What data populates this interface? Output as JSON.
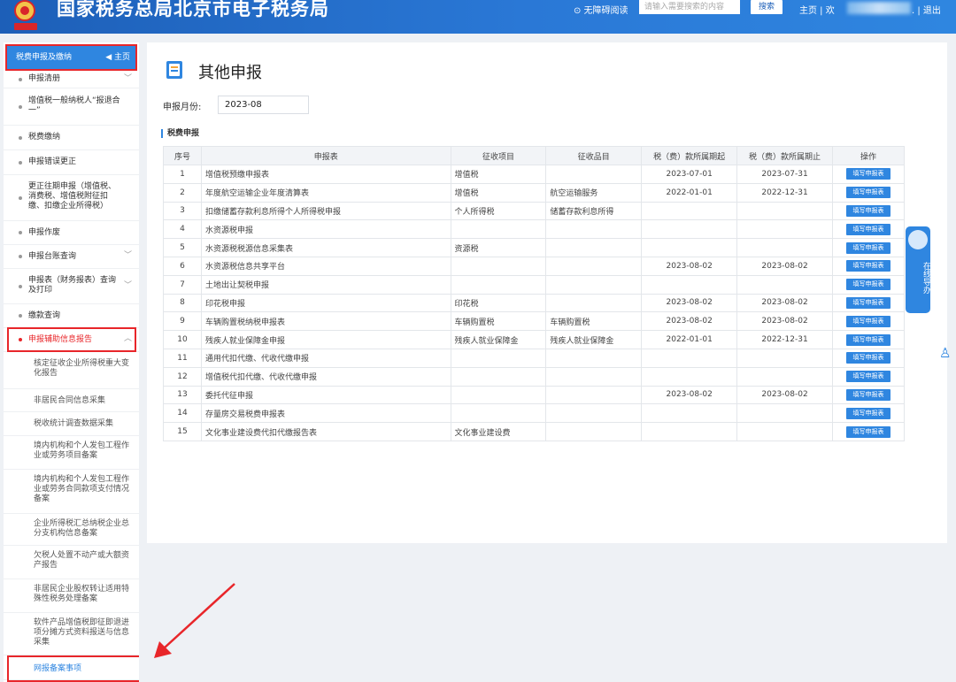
{
  "header": {
    "site_title": "国家税务总局北京市电子税务局",
    "accessibility": "⊙ 无障碍阅读",
    "search_placeholder": "请输入需要搜索的内容",
    "search_button": "搜索",
    "links": "主页 | 欢",
    "logout": ". | 退出"
  },
  "sidebar": {
    "header": "税费申报及缴纳",
    "home": "主页",
    "items": [
      {
        "label": "申报清册"
      },
      {
        "label": "增值税一般纳税人“报退合一”"
      },
      {
        "label": "税费缴纳"
      },
      {
        "label": "申报错误更正"
      },
      {
        "label": "更正往期申报（增值税、消费税、增值税附征扣缴、扣缴企业所得税）"
      },
      {
        "label": "申报作废"
      },
      {
        "label": "申报台账查询"
      },
      {
        "label": "申报表（财务报表）查询及打印"
      },
      {
        "label": "缴款查询"
      },
      {
        "label": "申报辅助信息报告"
      }
    ],
    "subitems": [
      {
        "label": "核定征收企业所得税重大变化报告"
      },
      {
        "label": "非居民合同信息采集"
      },
      {
        "label": "税收统计调查数据采集"
      },
      {
        "label": "境内机构和个人发包工程作业或劳务项目备案"
      },
      {
        "label": "境内机构和个人发包工程作业或劳务合同款项支付情况备案"
      },
      {
        "label": "企业所得税汇总纳税企业总分支机构信息备案"
      },
      {
        "label": "欠税人处置不动产或大额资产报告"
      },
      {
        "label": "非居民企业股权转让适用特殊性税务处理备案"
      },
      {
        "label": "软件产品增值税即征即退进项分摊方式资料报送与信息采集"
      },
      {
        "label": "网报备案事项"
      }
    ]
  },
  "main": {
    "title": "其他申报",
    "month_label": "申报月份:",
    "month_value": "2023-08",
    "section_title": "税费申报",
    "columns": [
      "序号",
      "申报表",
      "征收项目",
      "征收品目",
      "税（费）款所属期起",
      "税（费）款所属期止",
      "操作"
    ],
    "button_label": "填写申报表",
    "rows": [
      {
        "no": "1",
        "name": "增值税预缴申报表",
        "item": "增值税",
        "sub": "",
        "start": "2023-07-01",
        "end": "2023-07-31"
      },
      {
        "no": "2",
        "name": "年度航空运输企业年度清算表",
        "item": "增值税",
        "sub": "航空运输服务",
        "start": "2022-01-01",
        "end": "2022-12-31"
      },
      {
        "no": "3",
        "name": "扣缴储蓄存款利息所得个人所得税申报",
        "item": "个人所得税",
        "sub": "储蓄存款利息所得",
        "start": "",
        "end": ""
      },
      {
        "no": "4",
        "name": "水资源税申报",
        "item": "",
        "sub": "",
        "start": "",
        "end": ""
      },
      {
        "no": "5",
        "name": "水资源税税源信息采集表",
        "item": "资源税",
        "sub": "",
        "start": "",
        "end": ""
      },
      {
        "no": "6",
        "name": "水资源税信息共享平台",
        "item": "",
        "sub": "",
        "start": "2023-08-02",
        "end": "2023-08-02"
      },
      {
        "no": "7",
        "name": "土地出让契税申报",
        "item": "",
        "sub": "",
        "start": "",
        "end": ""
      },
      {
        "no": "8",
        "name": "印花税申报",
        "item": "印花税",
        "sub": "",
        "start": "2023-08-02",
        "end": "2023-08-02"
      },
      {
        "no": "9",
        "name": "车辆购置税纳税申报表",
        "item": "车辆购置税",
        "sub": "车辆购置税",
        "start": "2023-08-02",
        "end": "2023-08-02"
      },
      {
        "no": "10",
        "name": "残疾人就业保障金申报",
        "item": "残疾人就业保障金",
        "sub": "残疾人就业保障金",
        "start": "2022-01-01",
        "end": "2022-12-31"
      },
      {
        "no": "11",
        "name": "通用代扣代缴、代收代缴申报",
        "item": "",
        "sub": "",
        "start": "",
        "end": ""
      },
      {
        "no": "12",
        "name": "增值税代扣代缴、代收代缴申报",
        "item": "",
        "sub": "",
        "start": "",
        "end": ""
      },
      {
        "no": "13",
        "name": "委托代征申报",
        "item": "",
        "sub": "",
        "start": "2023-08-02",
        "end": "2023-08-02"
      },
      {
        "no": "14",
        "name": "存量房交易税费申报表",
        "item": "",
        "sub": "",
        "start": "",
        "end": ""
      },
      {
        "no": "15",
        "name": "文化事业建设费代扣代缴报告表",
        "item": "文化事业建设费",
        "sub": "",
        "start": "",
        "end": ""
      }
    ]
  },
  "guide": {
    "label": "在线导办"
  },
  "colors": {
    "accent": "#2f86e0",
    "highlight": "#e8262a"
  }
}
